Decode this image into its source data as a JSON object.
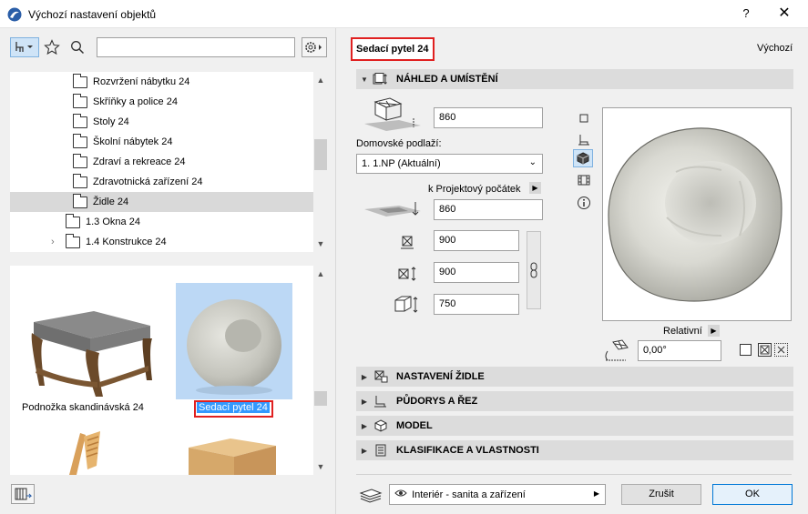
{
  "window": {
    "title": "Výchozí nastavení objektů",
    "help": "?",
    "close": "✕"
  },
  "library": {
    "search_placeholder": "",
    "tree": [
      {
        "label": "Rozvržení nábytku 24"
      },
      {
        "label": "Skříňky a police 24"
      },
      {
        "label": "Stoly 24"
      },
      {
        "label": "Školní nábytek 24"
      },
      {
        "label": "Zdraví a rekreace 24"
      },
      {
        "label": "Zdravotnická zařízení 24"
      },
      {
        "label": "Židle 24",
        "selected": true
      },
      {
        "label": "1.3 Okna 24"
      },
      {
        "label": "1.4 Konstrukce 24"
      }
    ],
    "thumbnails": [
      {
        "label": "Podnožka skandinávská 24"
      },
      {
        "label": "Sedací pytel 24",
        "selected": true
      }
    ]
  },
  "object": {
    "name": "Sedací pytel 24",
    "default_label": "Výchozí"
  },
  "panels": {
    "preview_placement": "NÁHLED A UMÍSTĚNÍ",
    "chair_settings": "NASTAVENÍ ŽIDLE",
    "floor_plan_section": "PŮDORYS A ŘEZ",
    "model": "MODEL",
    "classification": "KLASIFIKACE A VLASTNOSTI"
  },
  "placement": {
    "top_height": "860",
    "home_story_label": "Domovské podlaží:",
    "home_story_value": "1. 1.NP (Aktuální)",
    "reference_label": "k Projektový počátek",
    "elevation": "860",
    "width": "900",
    "depth": "900",
    "height": "750",
    "relative_label": "Relativní",
    "angle": "0,00°"
  },
  "footer": {
    "layer_value": "Interiér - sanita a zařízení",
    "cancel": "Zrušit",
    "ok": "OK"
  },
  "colors": {
    "accent": "#0078d7",
    "highlight_box": "#e02020",
    "selection_blue": "#3399ff"
  }
}
